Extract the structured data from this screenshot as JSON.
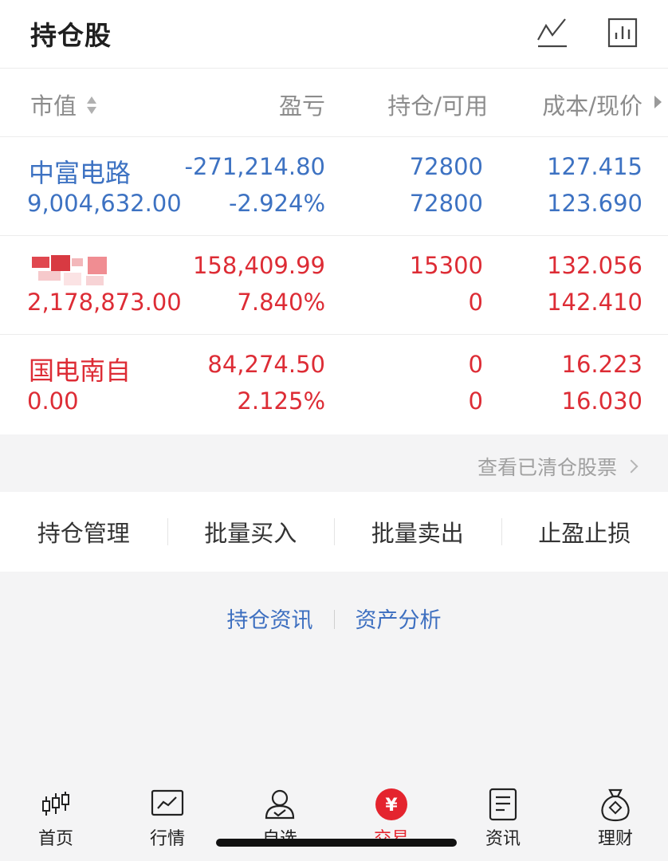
{
  "header": {
    "title": "持仓股",
    "icons": [
      "line-chart-icon",
      "bar-chart-icon"
    ]
  },
  "table": {
    "columns": {
      "market_value": "市值",
      "profit_loss": "盈亏",
      "holding_available": "持仓/可用",
      "cost_price": "成本/现价"
    },
    "rows": [
      {
        "name": "中富电路",
        "market_value": "9,004,632.00",
        "profit_loss": "-271,214.80",
        "profit_loss_pct": "-2.924%",
        "holding": "72800",
        "available": "72800",
        "cost": "127.415",
        "price": "123.690",
        "color": "#3d72c2"
      },
      {
        "name": "",
        "market_value": "2,178,873.00",
        "profit_loss": "158,409.99",
        "profit_loss_pct": "7.840%",
        "holding": "15300",
        "available": "0",
        "cost": "132.056",
        "price": "142.410",
        "color": "#dd2c35"
      },
      {
        "name": "国电南自",
        "market_value": "0.00",
        "profit_loss": "84,274.50",
        "profit_loss_pct": "2.125%",
        "holding": "0",
        "available": "0",
        "cost": "16.223",
        "price": "16.030",
        "color": "#dd2c35"
      }
    ]
  },
  "cleared_link": "查看已清仓股票",
  "actions": [
    "持仓管理",
    "批量买入",
    "批量卖出",
    "止盈止损"
  ],
  "links": [
    "持仓资讯",
    "资产分析"
  ],
  "tabbar": {
    "tabs": [
      {
        "label": "首页",
        "icon": "candlestick-icon"
      },
      {
        "label": "行情",
        "icon": "market-chart-icon"
      },
      {
        "label": "自选",
        "icon": "user-check-icon"
      },
      {
        "label": "交易",
        "icon": "yuan-icon",
        "active": true
      },
      {
        "label": "资讯",
        "icon": "document-icon"
      },
      {
        "label": "理财",
        "icon": "money-bag-icon"
      }
    ],
    "active_color": "#e4242e"
  }
}
